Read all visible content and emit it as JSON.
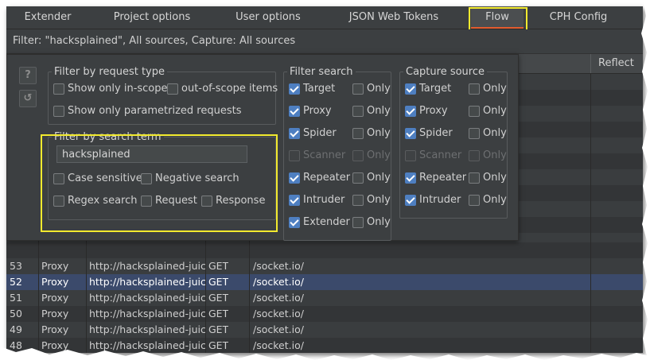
{
  "tabs": [
    {
      "label": "Extender"
    },
    {
      "label": "Project options"
    },
    {
      "label": "User options"
    },
    {
      "label": "JSON Web Tokens"
    },
    {
      "label": "Flow"
    },
    {
      "label": "CPH Config"
    }
  ],
  "active_tab": "Flow",
  "filter_summary": "Filter: \"hacksplained\", All sources, Capture: All sources",
  "table": {
    "reflect_header": "Reflect",
    "rows": [
      {
        "num": "53",
        "source": "Proxy",
        "host": "http://hacksplained-juic...",
        "method": "GET",
        "path": "/socket.io/"
      },
      {
        "num": "52",
        "source": "Proxy",
        "host": "http://hacksplained-juic...",
        "method": "GET",
        "path": "/socket.io/"
      },
      {
        "num": "51",
        "source": "Proxy",
        "host": "http://hacksplained-juic...",
        "method": "GET",
        "path": "/socket.io/"
      },
      {
        "num": "50",
        "source": "Proxy",
        "host": "http://hacksplained-juic...",
        "method": "GET",
        "path": "/socket.io/"
      },
      {
        "num": "49",
        "source": "Proxy",
        "host": "http://hacksplained-juic...",
        "method": "GET",
        "path": "/socket.io/"
      },
      {
        "num": "48",
        "source": "Proxy",
        "host": "http://hacksplained-juic...",
        "method": "GET",
        "path": "/socket.io/"
      }
    ],
    "selected_num": "52"
  },
  "popup": {
    "help_icon": "?",
    "reset_icon": "↺",
    "request_type": {
      "title": "Filter by request type",
      "in_scope": "Show only in-scope",
      "out_of_scope": "out-of-scope items",
      "parametrized": "Show only parametrized requests"
    },
    "search_term": {
      "title": "Filter by search term",
      "value": "hacksplained",
      "case_sensitive": "Case sensitive",
      "negative": "Negative search",
      "regex": "Regex search",
      "request": "Request",
      "response": "Response"
    },
    "filter_search": {
      "title": "Filter search",
      "only_label": "Only",
      "items": [
        {
          "label": "Target",
          "checked": true,
          "disabled": false
        },
        {
          "label": "Proxy",
          "checked": true,
          "disabled": false
        },
        {
          "label": "Spider",
          "checked": true,
          "disabled": false
        },
        {
          "label": "Scanner",
          "checked": false,
          "disabled": true
        },
        {
          "label": "Repeater",
          "checked": true,
          "disabled": false
        },
        {
          "label": "Intruder",
          "checked": true,
          "disabled": false
        },
        {
          "label": "Extender",
          "checked": true,
          "disabled": false
        }
      ]
    },
    "capture_source": {
      "title": "Capture source",
      "only_label": "Only",
      "items": [
        {
          "label": "Target",
          "checked": true,
          "disabled": false
        },
        {
          "label": "Proxy",
          "checked": true,
          "disabled": false
        },
        {
          "label": "Spider",
          "checked": true,
          "disabled": false
        },
        {
          "label": "Scanner",
          "checked": false,
          "disabled": true
        },
        {
          "label": "Repeater",
          "checked": true,
          "disabled": false
        },
        {
          "label": "Intruder",
          "checked": true,
          "disabled": false
        }
      ]
    }
  },
  "colors": {
    "highlight": "#f2ea2e",
    "active_tab_underline": "#e35b2e",
    "checkbox_checked": "#4e7fc1",
    "selected_row": "#3b4a6b"
  }
}
